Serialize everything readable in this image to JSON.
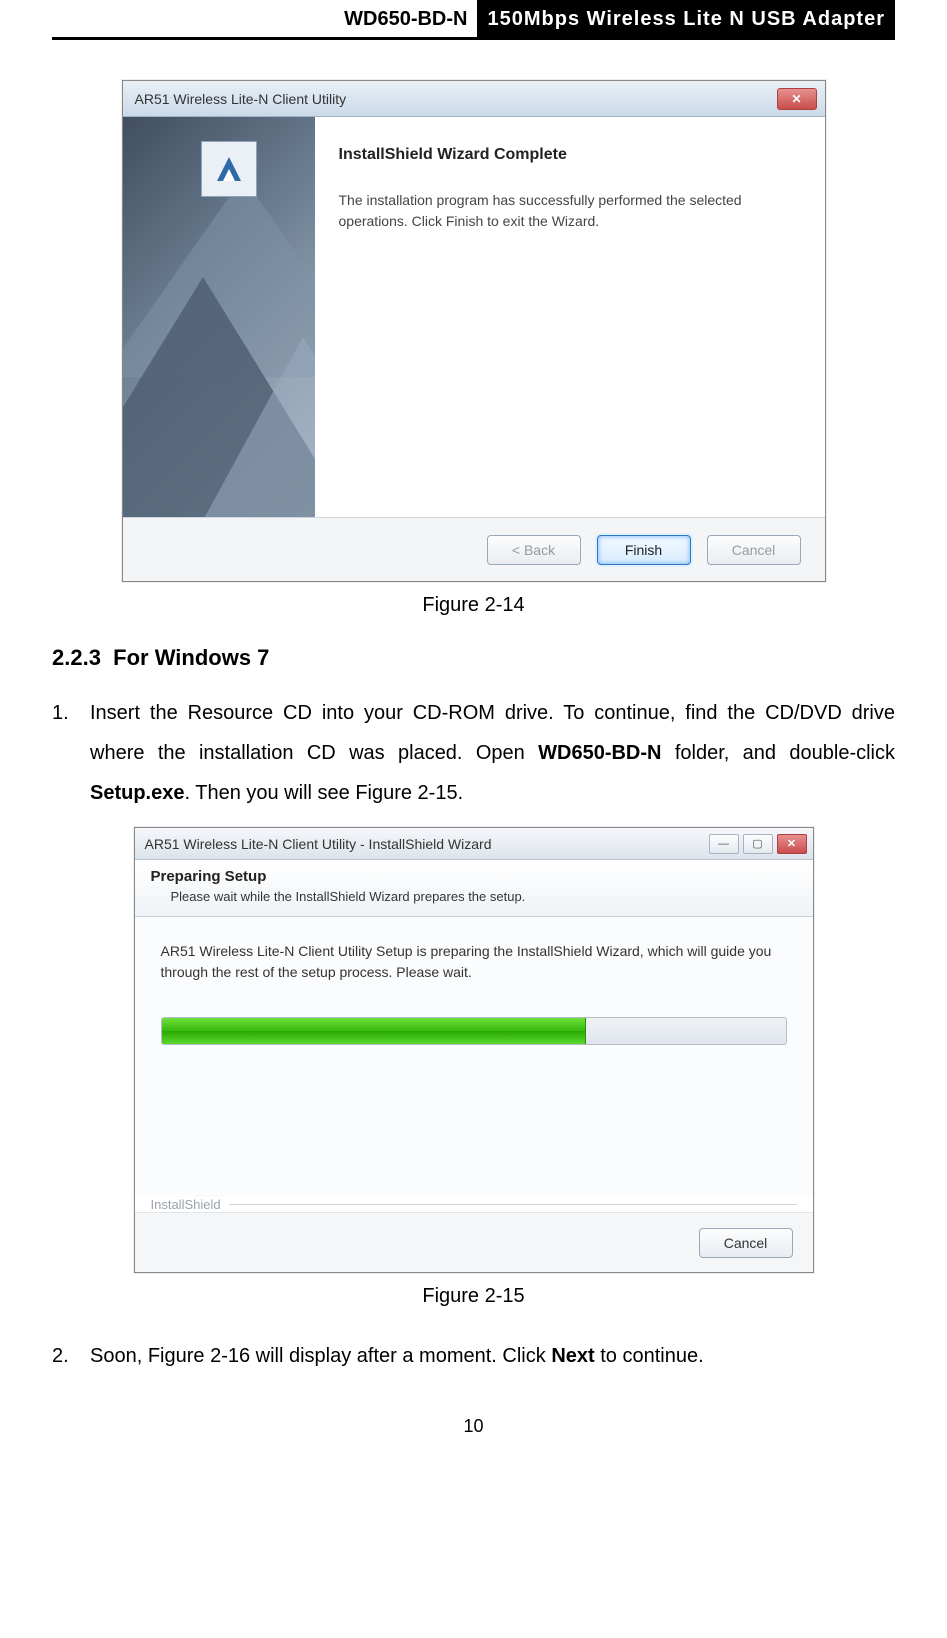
{
  "header": {
    "model": "WD650-BD-N",
    "product": "150Mbps Wireless Lite N USB Adapter"
  },
  "dialog1": {
    "title": "AR51 Wireless Lite-N Client Utility",
    "heading": "InstallShield Wizard Complete",
    "body": "The installation program has successfully performed the selected operations.  Click Finish to exit the Wizard.",
    "buttons": {
      "back": "< Back",
      "finish": "Finish",
      "cancel": "Cancel"
    }
  },
  "caption1": "Figure 2-14",
  "section": {
    "num": "2.2.3",
    "title": "For Windows 7"
  },
  "step1": {
    "num": "1.",
    "pre": "Insert the Resource CD into your CD-ROM drive. To continue, find the CD/DVD drive where the installation CD was placed. Open ",
    "bold1": "WD650-BD-N",
    "mid": " folder, and double-click ",
    "bold2": "Setup.exe",
    "post": ". Then you will see Figure 2-15."
  },
  "dialog2": {
    "title": "AR51 Wireless Lite-N Client Utility - InstallShield Wizard",
    "heading": "Preparing Setup",
    "sub": "Please wait while the InstallShield Wizard prepares the setup.",
    "body": "AR51 Wireless Lite-N Client Utility Setup is preparing the InstallShield Wizard, which will guide you through the rest of the setup process. Please wait.",
    "brand": "InstallShield",
    "buttons": {
      "cancel": "Cancel"
    }
  },
  "caption2": "Figure 2-15",
  "step2": {
    "num": "2.",
    "pre": "Soon, Figure 2-16 will display after a moment. Click ",
    "bold1": "Next",
    "post": " to continue."
  },
  "pagenum": "10"
}
